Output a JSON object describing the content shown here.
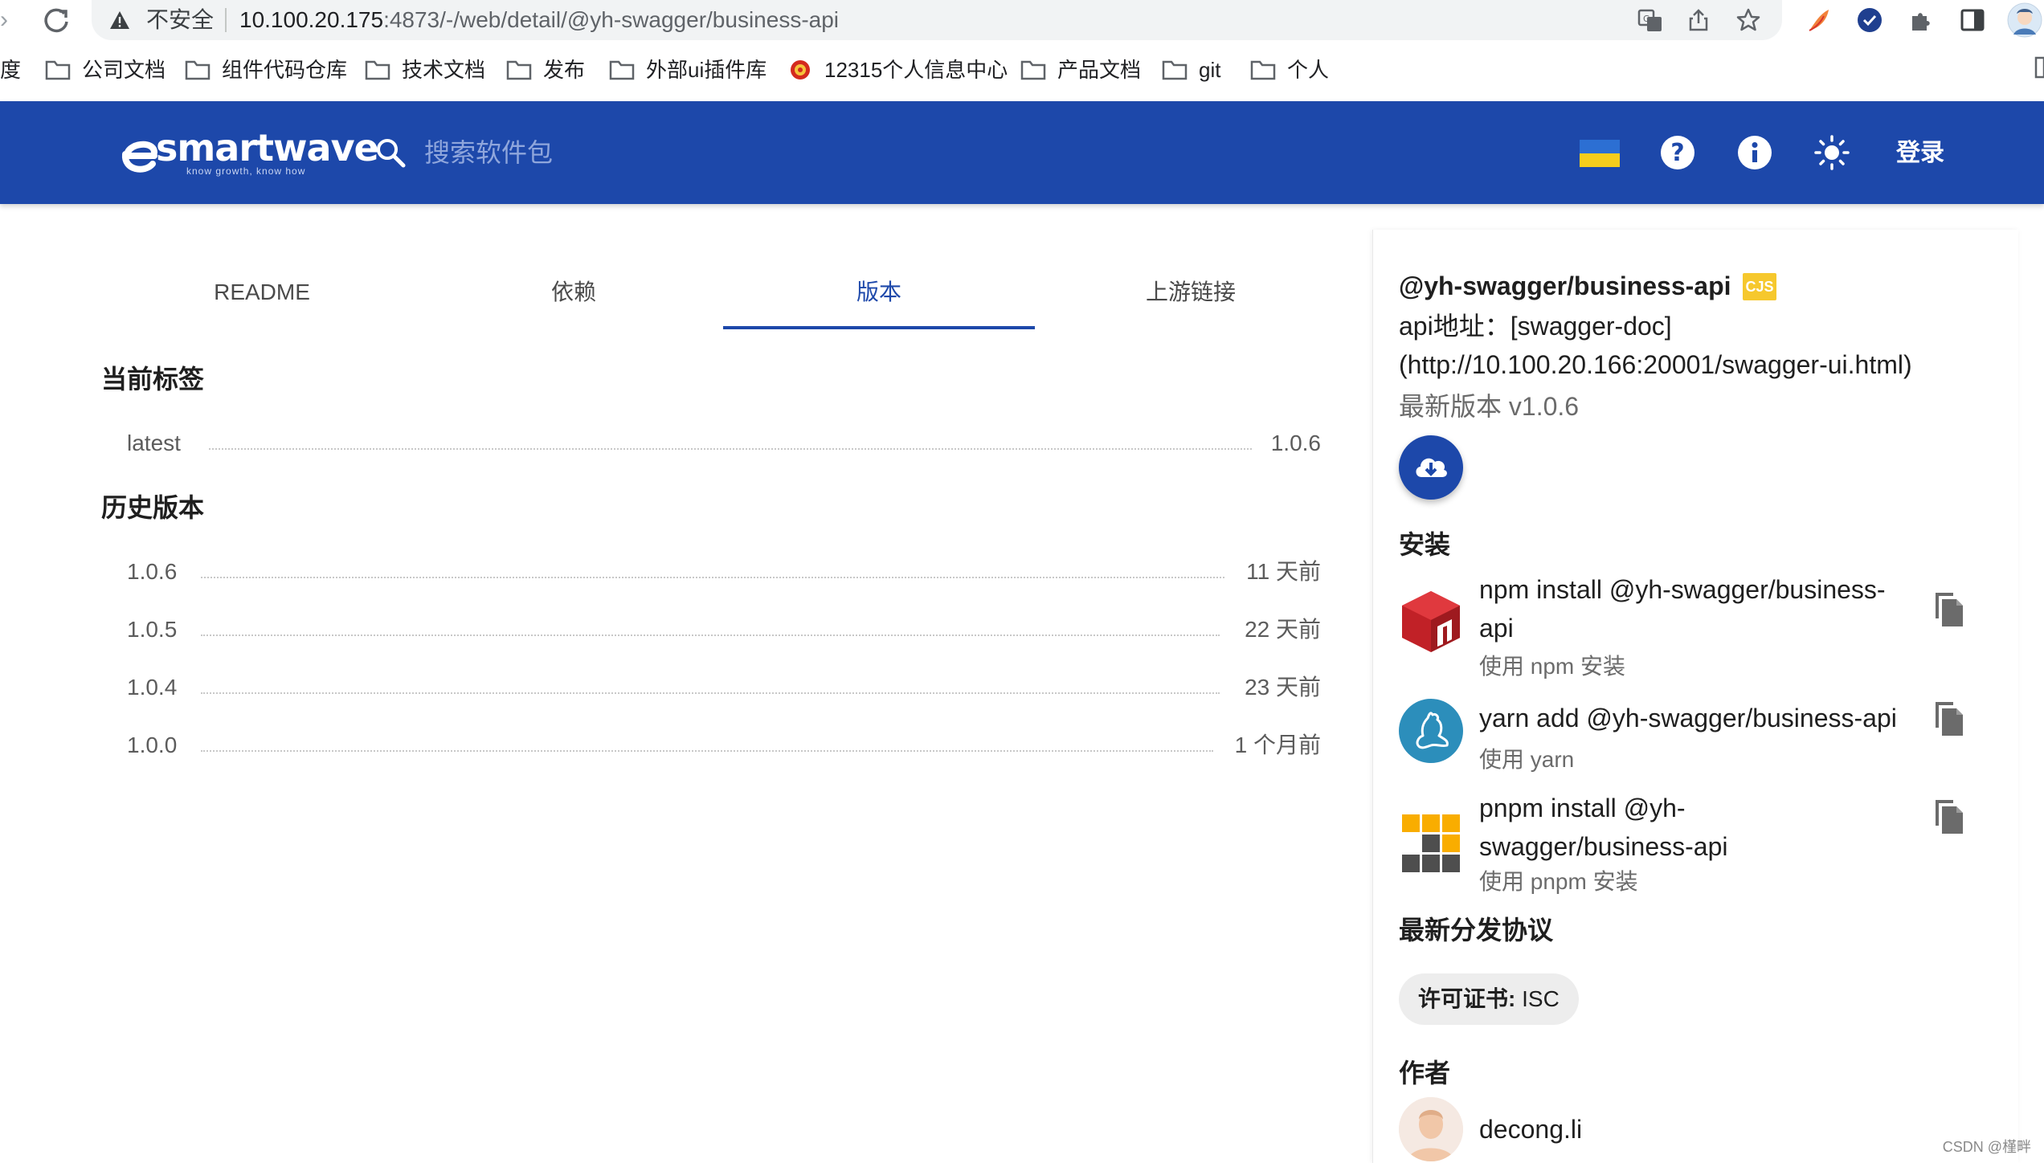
{
  "browser": {
    "security_label": "不安全",
    "url_host": "10.100.20.175",
    "url_rest": ":4873/-/web/detail/@yh-swagger/business-api",
    "bookmarks": [
      {
        "label": "度",
        "folder": false
      },
      {
        "label": "公司文档",
        "folder": true
      },
      {
        "label": "组件代码仓库",
        "folder": true
      },
      {
        "label": "技术文档",
        "folder": true
      },
      {
        "label": "发布",
        "folder": true
      },
      {
        "label": "外部ui插件库",
        "folder": true
      },
      {
        "label": "12315个人信息中心",
        "folder": false
      },
      {
        "label": "产品文档",
        "folder": true
      },
      {
        "label": "git",
        "folder": true
      },
      {
        "label": "个人",
        "folder": true
      }
    ]
  },
  "header": {
    "logo_text": "smartwave",
    "logo_tagline": "know growth, know how",
    "search_placeholder": "搜索软件包",
    "login_label": "登录",
    "icons": [
      "help-icon",
      "info-icon",
      "theme-toggle-icon"
    ],
    "flag_colors": {
      "top": "#2c6fd3",
      "bottom": "#f5cd1c"
    },
    "accent_color": "#1d48aa"
  },
  "tabs": [
    {
      "label": "README",
      "active": false
    },
    {
      "label": "依赖",
      "active": false
    },
    {
      "label": "版本",
      "active": true
    },
    {
      "label": "上游链接",
      "active": false
    }
  ],
  "versions": {
    "current_title": "当前标签",
    "current_tags": [
      {
        "name": "latest",
        "value": "1.0.6"
      }
    ],
    "history_title": "历史版本",
    "history": [
      {
        "name": "1.0.6",
        "value": "11 天前"
      },
      {
        "name": "1.0.5",
        "value": "22 天前"
      },
      {
        "name": "1.0.4",
        "value": "23 天前"
      },
      {
        "name": "1.0.0",
        "value": "1 个月前"
      }
    ]
  },
  "sidebar": {
    "package_name": "@yh-swagger/business-api",
    "module_badge": "CJS",
    "description": "api地址：[swagger-doc](http://10.100.20.166:20001/swagger-ui.html)",
    "latest_version": "最新版本 v1.0.6",
    "install_title": "安装",
    "installs": [
      {
        "command": "npm install @yh-swagger/business-api",
        "subtitle": "使用 npm 安装",
        "logo": "npm-logo"
      },
      {
        "command": "yarn add @yh-swagger/business-api",
        "subtitle": "使用 yarn",
        "logo": "yarn-logo"
      },
      {
        "command": "pnpm install @yh-swagger/business-api",
        "subtitle": "使用 pnpm 安装",
        "logo": "pnpm-logo"
      }
    ],
    "license_title": "最新分发协议",
    "license_label": "许可证书:",
    "license_value": "ISC",
    "author_title": "作者",
    "author_name": "decong.li"
  },
  "watermark": "CSDN @槿畔"
}
